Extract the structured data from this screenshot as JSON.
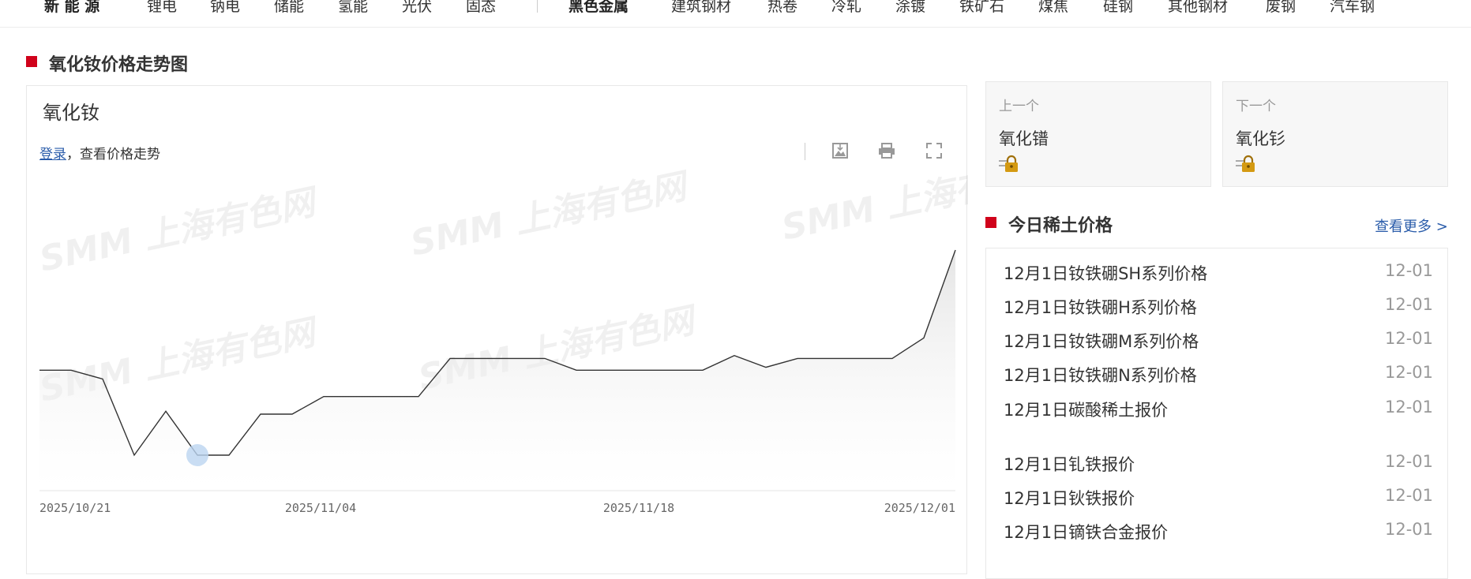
{
  "topnav": {
    "group1": [
      "新 能 源",
      "锂电",
      "钠电",
      "储能",
      "氢能",
      "光伏",
      "固态"
    ],
    "group2": [
      "黑色金属",
      "建筑钢材",
      "热卷",
      "冷轧",
      "涂镀",
      "铁矿石",
      "煤焦",
      "硅钢",
      "其他钢材",
      "废钢",
      "汽车钢"
    ]
  },
  "trend_section": {
    "title": "氧化钕价格走势图"
  },
  "chart_panel": {
    "name": "氧化钕",
    "login_link": "登录",
    "login_suffix": "，查看价格走势",
    "watermark": "SMM 上海有色网"
  },
  "icons": {
    "toolbar": [
      "image-download-icon",
      "print-icon",
      "fullscreen-icon"
    ],
    "lock": "lock-icon"
  },
  "colors": {
    "accent": "#d0021b",
    "link": "#2a5caa",
    "line": "#333333"
  },
  "chart_data": {
    "type": "area",
    "x_tick_labels": [
      "2025/10/21",
      "2025/11/04",
      "2025/11/18",
      "2025/12/01"
    ],
    "values": [
      5.9,
      5.9,
      5.6,
      3.0,
      4.5,
      3.0,
      3.0,
      4.4,
      4.4,
      5.0,
      5.0,
      5.0,
      5.0,
      6.3,
      6.3,
      6.3,
      6.3,
      5.9,
      5.9,
      5.9,
      5.9,
      5.9,
      6.4,
      6.0,
      6.3,
      6.3,
      6.3,
      6.3,
      7.0,
      10.0
    ],
    "highlight_index": 5,
    "grid": false,
    "legend": "none"
  },
  "nav_cards": {
    "prev": {
      "label": "上一个",
      "name": "氧化镨"
    },
    "next": {
      "label": "下一个",
      "name": "氧化钐"
    }
  },
  "today_section": {
    "title": "今日稀土价格",
    "more": "查看更多 >"
  },
  "price_list": [
    {
      "title": "12月1日钕铁硼SH系列价格",
      "date": "12-01"
    },
    {
      "title": "12月1日钕铁硼H系列价格",
      "date": "12-01"
    },
    {
      "title": "12月1日钕铁硼M系列价格",
      "date": "12-01"
    },
    {
      "title": "12月1日钕铁硼N系列价格",
      "date": "12-01"
    },
    {
      "title": "12月1日碳酸稀土报价",
      "date": "12-01"
    },
    {
      "title": "12月1日钆铁报价",
      "date": "12-01"
    },
    {
      "title": "12月1日钬铁报价",
      "date": "12-01"
    },
    {
      "title": "12月1日镝铁合金报价",
      "date": "12-01"
    }
  ]
}
